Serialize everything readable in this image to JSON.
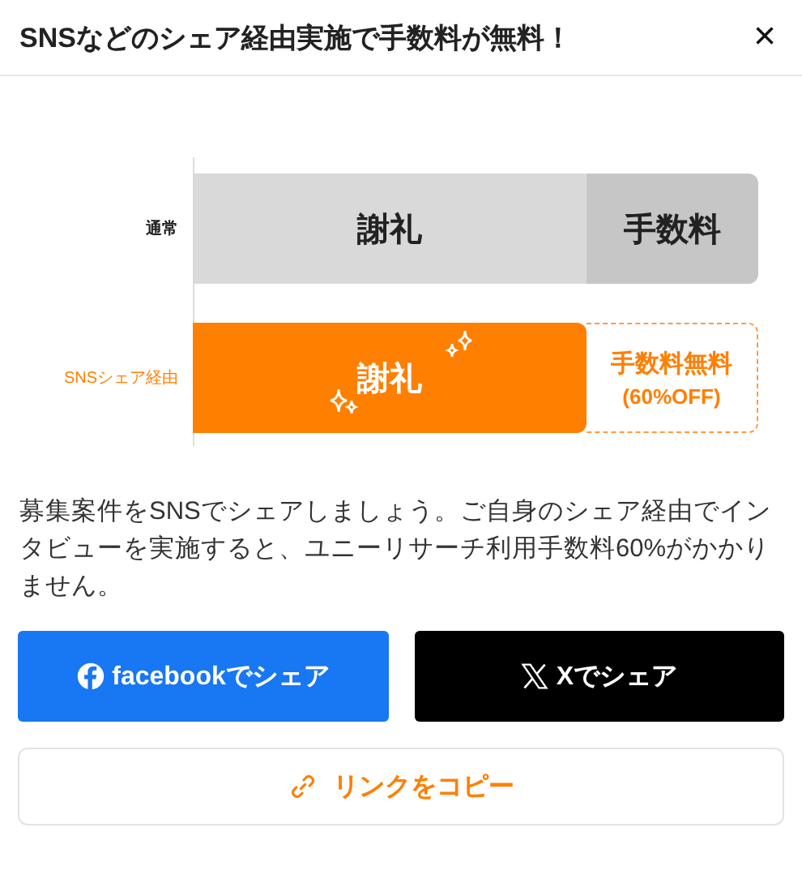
{
  "header": {
    "title": "SNSなどのシェア経由実施で手数料が無料！",
    "close": "×"
  },
  "comparison": {
    "rows": [
      {
        "kind": "normal",
        "label": "通常",
        "reward": "謝礼",
        "fee": [
          "手数料"
        ]
      },
      {
        "kind": "sns",
        "label": "SNSシェア経由",
        "reward": "謝礼",
        "fee": [
          "手数料無料",
          "(60%OFF)"
        ]
      }
    ]
  },
  "description": "募集案件をSNSでシェアしましょう。ご自身のシェア経由でインタビューを実施すると、ユニーリサーチ利用手数料60%がかかりません。",
  "buttons": [
    {
      "kind": "facebook",
      "label": "facebookでシェア"
    },
    {
      "kind": "x",
      "label": "Xでシェア"
    }
  ],
  "copy_button": {
    "label": "リンクをコピー"
  }
}
